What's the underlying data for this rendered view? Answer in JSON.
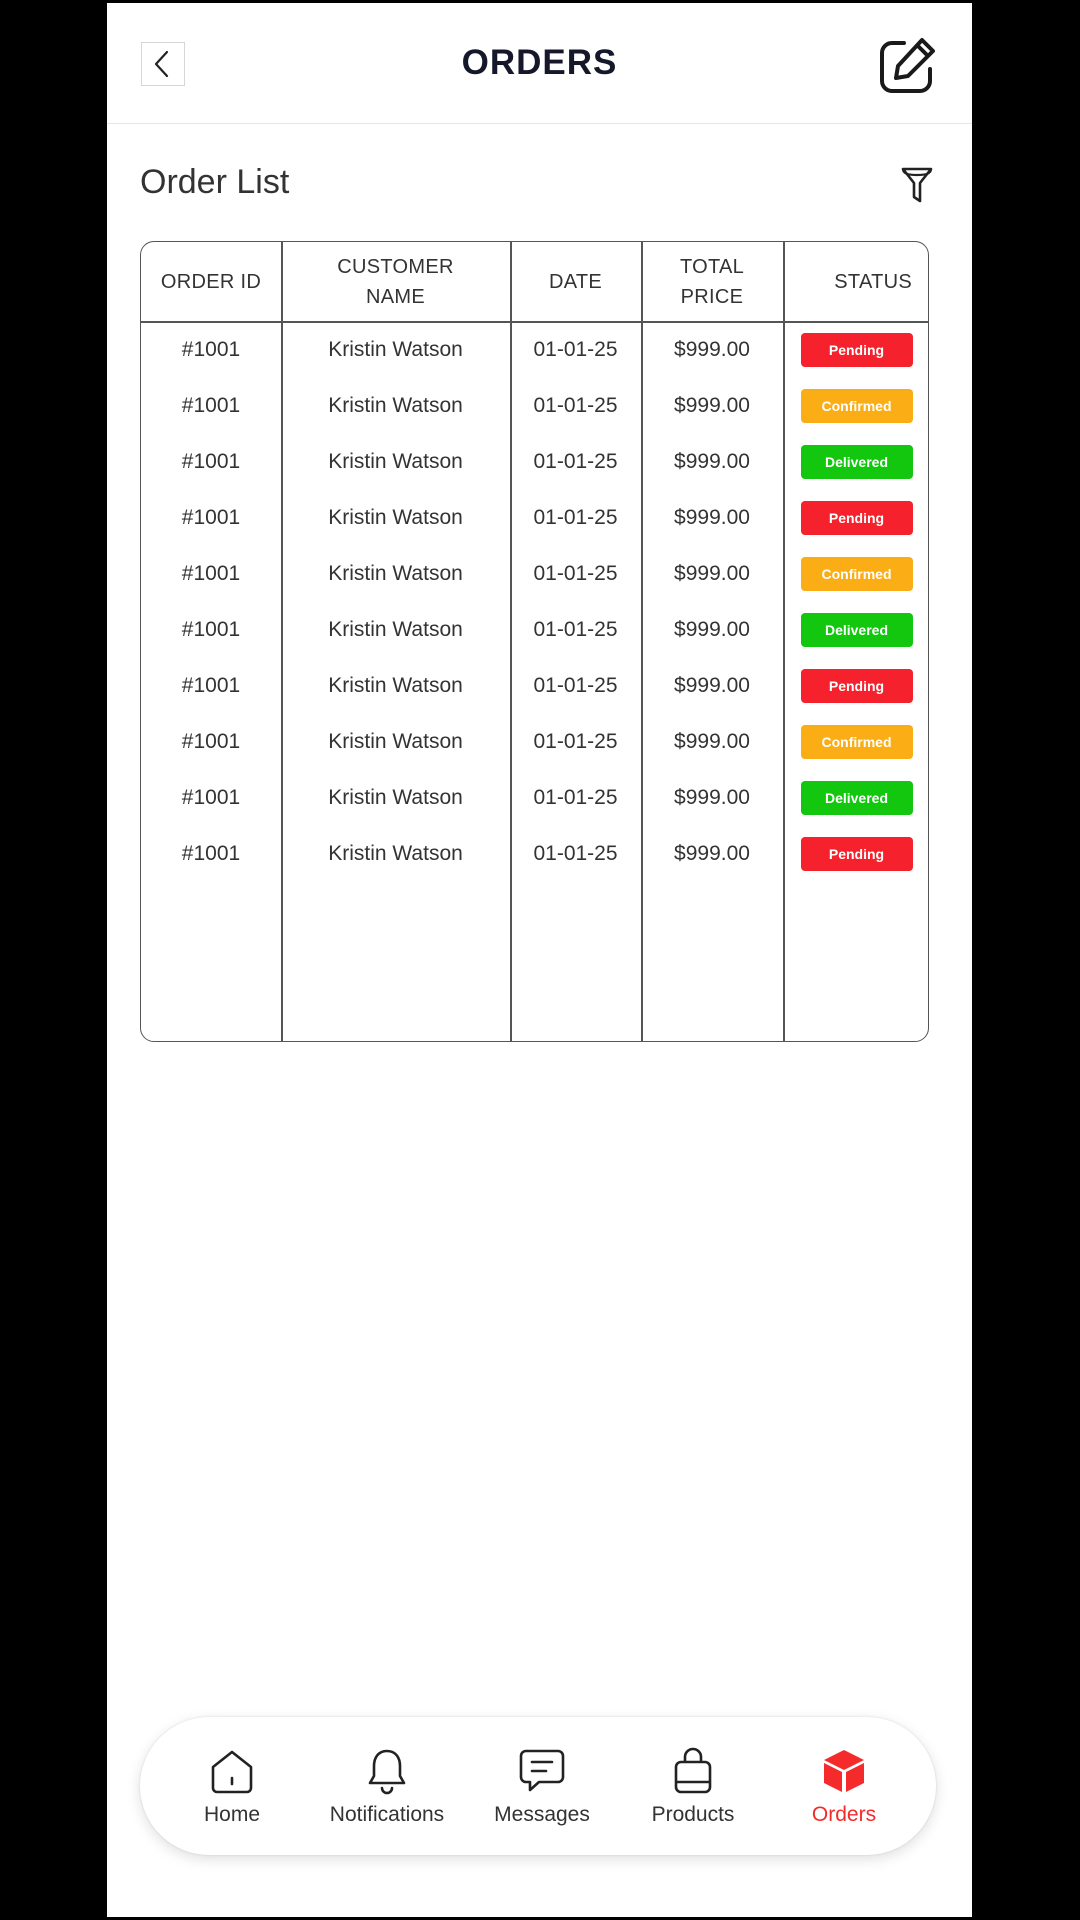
{
  "header": {
    "title": "ORDERS",
    "back_icon": "chevron-left-icon",
    "edit_icon": "edit-icon"
  },
  "section": {
    "title": "Order List",
    "filter_icon": "filter-icon"
  },
  "table": {
    "columns": [
      {
        "label_line1": "ORDER ID",
        "label_line2": ""
      },
      {
        "label_line1": "CUSTOMER",
        "label_line2": "NAME"
      },
      {
        "label_line1": "DATE",
        "label_line2": ""
      },
      {
        "label_line1": "TOTAL",
        "label_line2": "PRICE"
      },
      {
        "label_line1": "STATUS",
        "label_line2": ""
      }
    ],
    "rows": [
      {
        "order_id": "#1001",
        "customer": "Kristin Watson",
        "date": "01-01-25",
        "price": "$999.00",
        "status": "Pending"
      },
      {
        "order_id": "#1001",
        "customer": "Kristin Watson",
        "date": "01-01-25",
        "price": "$999.00",
        "status": "Confirmed"
      },
      {
        "order_id": "#1001",
        "customer": "Kristin Watson",
        "date": "01-01-25",
        "price": "$999.00",
        "status": "Delivered"
      },
      {
        "order_id": "#1001",
        "customer": "Kristin Watson",
        "date": "01-01-25",
        "price": "$999.00",
        "status": "Pending"
      },
      {
        "order_id": "#1001",
        "customer": "Kristin Watson",
        "date": "01-01-25",
        "price": "$999.00",
        "status": "Confirmed"
      },
      {
        "order_id": "#1001",
        "customer": "Kristin Watson",
        "date": "01-01-25",
        "price": "$999.00",
        "status": "Delivered"
      },
      {
        "order_id": "#1001",
        "customer": "Kristin Watson",
        "date": "01-01-25",
        "price": "$999.00",
        "status": "Pending"
      },
      {
        "order_id": "#1001",
        "customer": "Kristin Watson",
        "date": "01-01-25",
        "price": "$999.00",
        "status": "Confirmed"
      },
      {
        "order_id": "#1001",
        "customer": "Kristin Watson",
        "date": "01-01-25",
        "price": "$999.00",
        "status": "Delivered"
      },
      {
        "order_id": "#1001",
        "customer": "Kristin Watson",
        "date": "01-01-25",
        "price": "$999.00",
        "status": "Pending"
      }
    ]
  },
  "status_colors": {
    "Pending": "#f5222d",
    "Confirmed": "#faad14",
    "Delivered": "#13c70f"
  },
  "bottom_nav": {
    "items": [
      {
        "label": "Home",
        "icon": "home-icon",
        "active": false
      },
      {
        "label": "Notifications",
        "icon": "bell-icon",
        "active": false
      },
      {
        "label": "Messages",
        "icon": "message-icon",
        "active": false
      },
      {
        "label": "Products",
        "icon": "shopping-bag-icon",
        "active": false
      },
      {
        "label": "Orders",
        "icon": "box-icon",
        "active": true
      }
    ],
    "active_color": "#f52a2a"
  }
}
